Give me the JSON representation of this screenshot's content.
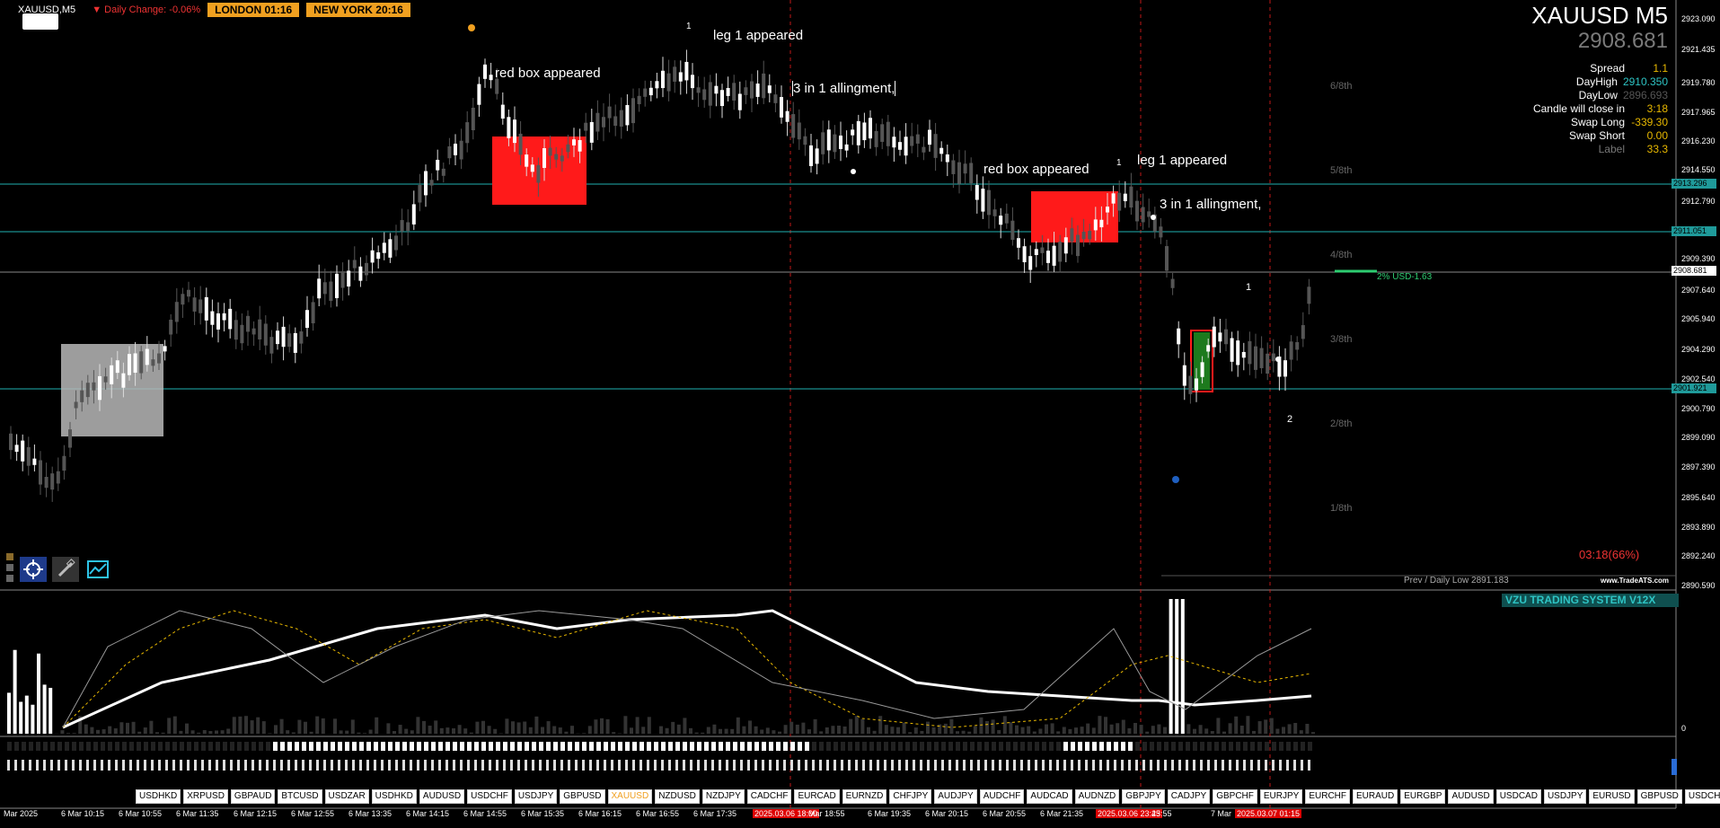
{
  "header": {
    "symbol_timeframe": "XAUUSD,M5",
    "daily_change": "▼ Daily Change: -0.06%",
    "sessions": [
      "LONDON  01:16",
      "NEW YORK  20:16"
    ]
  },
  "panel": {
    "symbol_title": "XAUUSD M5",
    "price": "2908.681",
    "rows": [
      {
        "label": "Spread",
        "value": "1.1",
        "color": "#e8b800"
      },
      {
        "label": "DayHigh",
        "value": "2910.350",
        "color": "#2ec4c4"
      },
      {
        "label": "DayLow",
        "value": "2896.693",
        "color": "#555555"
      },
      {
        "label": "Candle will close in",
        "value": "3:18",
        "color": "#e8b800"
      },
      {
        "label": "Swap Long",
        "value": "-339.30",
        "color": "#e8b800"
      },
      {
        "label": "Swap Short",
        "value": "0.00",
        "color": "#e8b800"
      },
      {
        "label": "Label",
        "value": "33.3",
        "color": "#e8b800"
      }
    ]
  },
  "annotations": {
    "red_box_1": "red box appeared",
    "leg_1_a": "leg 1 appeared",
    "align_1": "3 in 1 allingment,",
    "red_box_2": "red box appeared",
    "leg_1_b": "leg 1 appeared",
    "align_2": "3 in 1 allingment,",
    "mark_1a": "1",
    "mark_1b": "1",
    "mark_1c": "1",
    "mark_2": "2"
  },
  "price_axis": {
    "labels": [
      "2923.090",
      "2921.435",
      "2919.780",
      "2917.965",
      "2916.230",
      "2914.550",
      "2912.790",
      "2909.390",
      "2907.640",
      "2905.940",
      "2904.290",
      "2902.540",
      "2900.790",
      "2899.090",
      "2897.390",
      "2895.640",
      "2893.890",
      "2892.240",
      "2890.590"
    ],
    "tags": [
      {
        "text": "2913.296",
        "color": "#1f9a9a"
      },
      {
        "text": "2911.051",
        "color": "#1f9a9a"
      },
      {
        "text": "2908.681",
        "color": "#ffffff"
      },
      {
        "text": "2901.921",
        "color": "#1f9a9a"
      }
    ]
  },
  "fractions": [
    "6/8th",
    "5/8th",
    "4/8th",
    "3/8th",
    "2/8th",
    "1/8th"
  ],
  "candle_timer": "03:18(66%)",
  "prev_daily_low": "Prev / Daily Low 2891.183",
  "branding": "www.TradeATS.com",
  "indicator_title": "VZU TRADING SYSTEM V12X",
  "usd_label": "2% USD-1.63",
  "indicator_zero": "0",
  "symbols": [
    "USDHKD",
    "XRPUSD",
    "GBPAUD",
    "BTCUSD",
    "USDZAR",
    "USDHKD",
    "AUDUSD",
    "USDCHF",
    "USDJPY",
    "GBPUSD",
    "XAUUSD",
    "NZDUSD",
    "NZDJPY",
    "CADCHF",
    "EURCAD",
    "EURNZD",
    "CHFJPY",
    "AUDJPY",
    "AUDCHF",
    "AUDCAD",
    "AUDNZD",
    "GBPJPY",
    "CADJPY",
    "GBPCHF",
    "EURJPY",
    "EURCHF",
    "EURAUD",
    "EURGBP",
    "AUDUSD",
    "USDCAD",
    "USDJPY",
    "EURUSD",
    "GBPUSD",
    "USDCHF"
  ],
  "active_symbol": "XAUUSD",
  "time_labels": [
    {
      "text": "Mar 2025",
      "red": false
    },
    {
      "text": "6 Mar 10:15",
      "red": false
    },
    {
      "text": "6 Mar 10:55",
      "red": false
    },
    {
      "text": "6 Mar 11:35",
      "red": false
    },
    {
      "text": "6 Mar 12:15",
      "red": false
    },
    {
      "text": "6 Mar 12:55",
      "red": false
    },
    {
      "text": "6 Mar 13:35",
      "red": false
    },
    {
      "text": "6 Mar 14:15",
      "red": false
    },
    {
      "text": "6 Mar 14:55",
      "red": false
    },
    {
      "text": "6 Mar 15:35",
      "red": false
    },
    {
      "text": "6 Mar 16:15",
      "red": false
    },
    {
      "text": "6 Mar 16:55",
      "red": false
    },
    {
      "text": "6 Mar 17:35",
      "red": false
    },
    {
      "text": "2025.03.06 18:00",
      "red": true
    },
    {
      "text": "Mar 18:55",
      "red": false
    },
    {
      "text": "6 Mar 19:35",
      "red": false
    },
    {
      "text": "6 Mar 20:15",
      "red": false
    },
    {
      "text": "6 Mar 20:55",
      "red": false
    },
    {
      "text": "6 Mar 21:35",
      "red": false
    },
    {
      "text": "2025.03.06 23:45",
      "red": true
    },
    {
      "text": "23:55",
      "red": false
    },
    {
      "text": "7 Mar",
      "red": false
    },
    {
      "text": "2025.03.07 01:15",
      "red": true
    }
  ]
}
